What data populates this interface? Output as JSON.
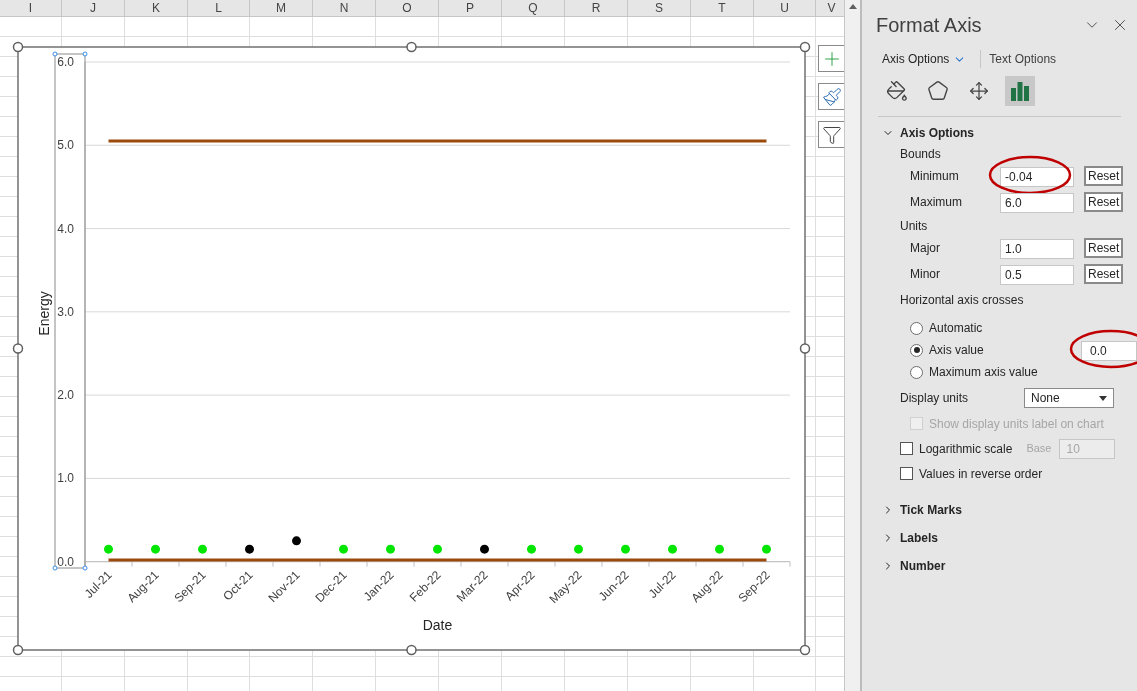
{
  "sheet": {
    "columns": [
      "I",
      "J",
      "K",
      "L",
      "M",
      "N",
      "O",
      "P",
      "Q",
      "R",
      "S",
      "T",
      "U",
      "V"
    ]
  },
  "chart": {
    "chart_data": {
      "type": "scatter",
      "xlabel": "Date",
      "ylabel": "Energy",
      "categories": [
        "Jul-21",
        "Aug-21",
        "Sep-21",
        "Oct-21",
        "Nov-21",
        "Dec-21",
        "Jan-22",
        "Feb-22",
        "Mar-22",
        "Apr-22",
        "May-22",
        "Jun-22",
        "Jul-22",
        "Aug-22",
        "Sep-22"
      ],
      "series": [
        {
          "color": "#00e600",
          "values": [
            0.15,
            0.15,
            0.15,
            null,
            null,
            0.15,
            0.15,
            0.15,
            null,
            0.15,
            0.15,
            0.15,
            0.15,
            0.15,
            0.15
          ]
        },
        {
          "color": "#000000",
          "values": [
            null,
            null,
            null,
            0.15,
            0.25,
            null,
            null,
            null,
            0.15,
            null,
            null,
            null,
            null,
            null,
            null
          ]
        }
      ],
      "ref_lines": [
        {
          "axis": "y",
          "value": 5.05,
          "color": "#9c4a0c"
        },
        {
          "axis": "y",
          "value": 0.02,
          "color": "#9c4a0c"
        }
      ],
      "ylim": [
        -0.04,
        6
      ],
      "grid": true,
      "yticks": [
        {
          "value": 0,
          "label": "0.0"
        },
        {
          "value": 1,
          "label": "1.0"
        },
        {
          "value": 2,
          "label": "2.0"
        },
        {
          "value": 3,
          "label": "3.0"
        },
        {
          "value": 4,
          "label": "4.0"
        },
        {
          "value": 5,
          "label": "5.0"
        },
        {
          "value": 6,
          "label": "6.0"
        }
      ]
    },
    "axis_selected": true
  },
  "pane": {
    "title": "Format Axis",
    "tabs": [
      {
        "label": "Axis Options",
        "selected": true
      },
      {
        "label": "Text Options",
        "selected": false
      }
    ],
    "icon_tabs": [
      {
        "kind": "fill",
        "selected": false
      },
      {
        "kind": "effects",
        "selected": false
      },
      {
        "kind": "size",
        "selected": false
      },
      {
        "kind": "options",
        "selected": true
      }
    ],
    "section": {
      "title": "Axis Options",
      "expanded": true,
      "bounds": {
        "label": "Bounds",
        "fields": [
          {
            "label": "Minimum",
            "value": "-0.04",
            "button": "Reset",
            "highlighted": true
          },
          {
            "label": "Maximum",
            "value": "6.0",
            "button": "Reset",
            "highlighted": false
          }
        ]
      },
      "units": {
        "label": "Units",
        "fields": [
          {
            "label": "Major",
            "value": "1.0",
            "button": "Reset",
            "highlighted": false
          },
          {
            "label": "Minor",
            "value": "0.5",
            "button": "Reset",
            "highlighted": false
          }
        ]
      },
      "crosses": {
        "label": "Horizontal axis crosses",
        "options": [
          {
            "label": "Automatic",
            "selected": false
          },
          {
            "label": "Axis value",
            "selected": true,
            "value": "0.0",
            "highlighted": true
          },
          {
            "label": "Maximum axis value",
            "selected": false
          }
        ]
      },
      "display_units": {
        "label": "Display units",
        "value": "None"
      },
      "checkboxes": [
        {
          "label": "Show display units label on chart",
          "checked": false,
          "disabled": true,
          "indented": true
        },
        {
          "label": "Logarithmic scale",
          "checked": false,
          "disabled": false,
          "indented": false,
          "base_label": "Base",
          "base_value": "10"
        },
        {
          "label": "Values in reverse order",
          "checked": false,
          "disabled": false,
          "indented": false
        }
      ]
    },
    "collapsed": [
      {
        "title": "Tick Marks",
        "expanded": false
      },
      {
        "title": "Labels",
        "expanded": false
      },
      {
        "title": "Number",
        "expanded": false
      }
    ]
  }
}
